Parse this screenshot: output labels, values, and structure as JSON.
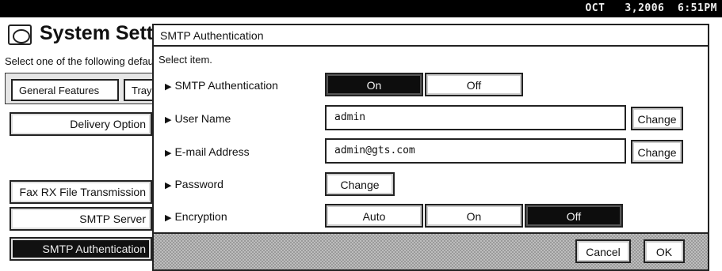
{
  "status_bar": {
    "date_time": "OCT   3,2006  6:51PM"
  },
  "background": {
    "title": "System Settings",
    "instruction": "Select one of the following default settings.",
    "tabs": [
      "General Features",
      "Tray Paper Settings"
    ],
    "buttons": [
      "Delivery Option",
      "Fax RX File Transmission",
      "SMTP Server",
      "SMTP Authentication"
    ]
  },
  "dialog": {
    "title": "SMTP Authentication",
    "subtitle": "Select item.",
    "smtp_auth": {
      "label": "SMTP Authentication",
      "on": "On",
      "off": "Off",
      "selected": "On"
    },
    "user_name": {
      "label": "User Name",
      "value": "admin",
      "change": "Change"
    },
    "email": {
      "label": "E-mail Address",
      "value": "admin@gts.com",
      "change": "Change"
    },
    "password": {
      "label": "Password",
      "change": "Change"
    },
    "encryption": {
      "label": "Encryption",
      "auto": "Auto",
      "on": "On",
      "off": "Off",
      "selected": "Off"
    },
    "cancel": "Cancel",
    "ok": "OK"
  }
}
